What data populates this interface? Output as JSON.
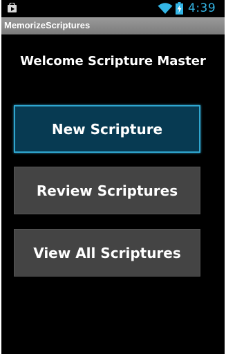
{
  "status_bar": {
    "notification_icon": "play-store-icon",
    "wifi_icon": "wifi-icon",
    "battery_icon": "battery-charging-icon",
    "time": "4:39",
    "clock_color": "#33b5e5"
  },
  "title_bar": {
    "title": "MemorizeScriptures"
  },
  "main": {
    "welcome": "Welcome Scripture Master",
    "buttons": [
      {
        "label": "New Scripture",
        "state": "focused"
      },
      {
        "label": "Review Scriptures",
        "state": "normal"
      },
      {
        "label": "View All Scriptures",
        "state": "normal"
      }
    ]
  },
  "colors": {
    "focused_border": "#2fa6cf",
    "focused_fill": "#073a52",
    "button_fill": "#444444",
    "background": "#000000"
  }
}
